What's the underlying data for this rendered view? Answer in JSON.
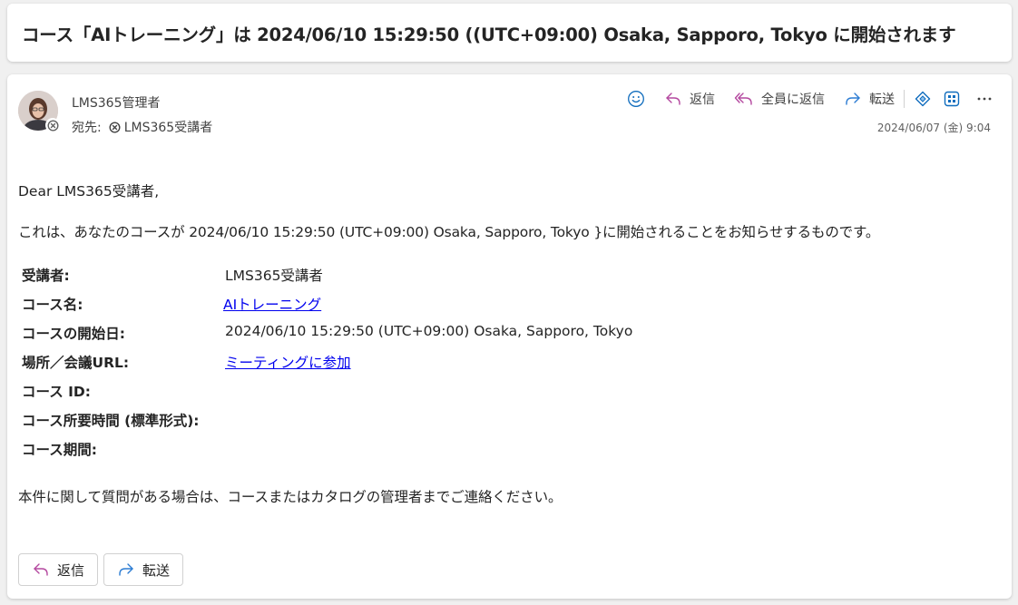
{
  "subject": "コース「AIトレーニング」は 2024/06/10 15:29:50 ((UTC+09:00) Osaka, Sapporo, Tokyo に開始されます",
  "message": {
    "sender": "LMS365管理者",
    "to_label": "宛先:",
    "to_value": "LMS365受講者",
    "timestamp": "2024/06/07 (金) 9:04",
    "actions": {
      "reply": "返信",
      "reply_all": "全員に返信",
      "forward": "転送"
    }
  },
  "body": {
    "greeting": "Dear LMS365受講者,",
    "intro": "これは、あなたのコースが 2024/06/10 15:29:50 (UTC+09:00) Osaka, Sapporo, Tokyo }に開始されることをお知らせするものです。",
    "details": [
      {
        "key": "受講者:",
        "value": "LMS365受講者"
      },
      {
        "key": "コース名:",
        "value": "AIトレーニング"
      },
      {
        "key": "コースの開始日:",
        "value": "2024/06/10 15:29:50 (UTC+09:00) Osaka, Sapporo, Tokyo"
      },
      {
        "key": "場所／会議URL:",
        "value": "ミーティングに参加"
      },
      {
        "key": "コース ID:",
        "value": ""
      },
      {
        "key": "コース所要時間 (標準形式):",
        "value": ""
      },
      {
        "key": "コース期間:",
        "value": ""
      }
    ],
    "closing": "本件に関して質問がある場合は、コースまたはカタログの管理者までご連絡ください。"
  },
  "footer_buttons": {
    "reply": "返信",
    "forward": "転送"
  },
  "colors": {
    "reply_icon": "#b4489f",
    "forward_icon": "#2b7cd3",
    "link": "#0000ee",
    "accent": "#0f6cbd"
  }
}
